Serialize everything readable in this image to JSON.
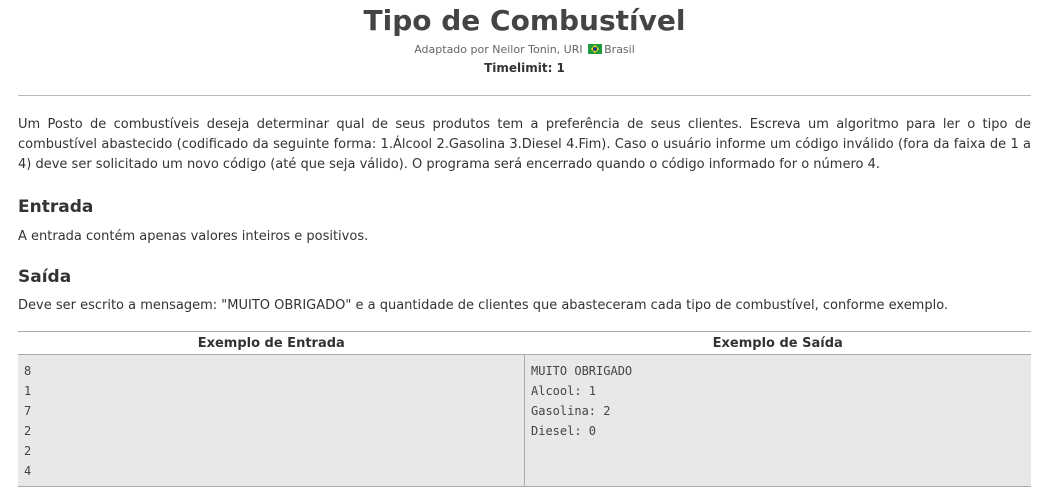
{
  "problem": {
    "title": "Tipo de Combustível",
    "author_prefix": "Adaptado por Neilor Tonin, URI",
    "country": "Brasil",
    "timelimit": "Timelimit: 1",
    "description": "Um Posto de combustíveis deseja determinar qual de seus produtos tem a preferência de seus clientes. Escreva um algoritmo para ler o tipo de combustível abastecido (codificado da seguinte forma: 1.Álcool 2.Gasolina 3.Diesel 4.Fim). Caso o usuário informe um código inválido (fora da faixa de 1 a 4) deve ser solicitado um novo código (até que seja válido). O programa será encerrado quando o código informado for o número 4."
  },
  "input_section": {
    "heading": "Entrada",
    "text": "A entrada contém apenas valores inteiros e positivos."
  },
  "output_section": {
    "heading": "Saída",
    "text": "Deve ser escrito a mensagem: \"MUITO OBRIGADO\" e a quantidade de clientes que abasteceram cada tipo de combustível, conforme exemplo."
  },
  "examples": {
    "input_header": "Exemplo de Entrada",
    "output_header": "Exemplo de Saída",
    "input_lines": [
      "8",
      "1",
      "7",
      "2",
      "2",
      "4"
    ],
    "output_lines": [
      "MUITO OBRIGADO",
      "Alcool: 1",
      "Gasolina: 2",
      "Diesel: 0"
    ]
  }
}
